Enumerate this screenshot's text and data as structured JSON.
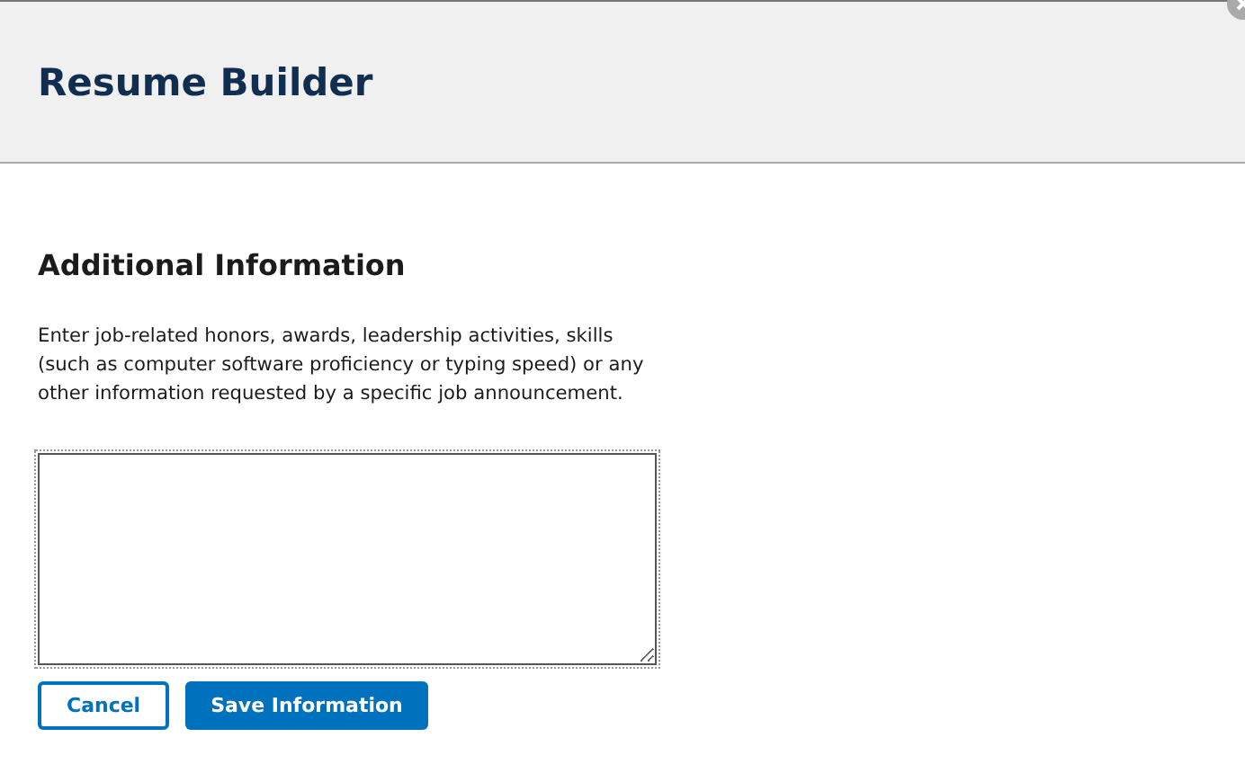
{
  "header": {
    "title": "Resume Builder"
  },
  "section": {
    "heading": "Additional Information",
    "description": "Enter job-related honors, awards, leadership activities, skills (such as computer software proficiency or typing speed) or any other information requested by a specific job announcement.",
    "field": {
      "focused": true
    }
  },
  "buttons": [
    {
      "label": "Cancel",
      "kind": "secondary"
    },
    {
      "label": "Save Information",
      "kind": "primary"
    }
  ]
}
